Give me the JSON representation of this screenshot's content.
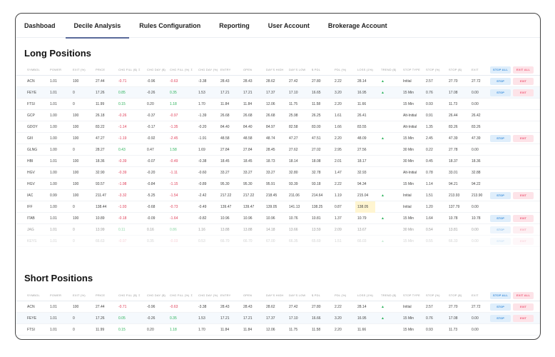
{
  "tabs": [
    "Dashboad",
    "Decile Analysis",
    "Rules Configuration",
    "Reporting",
    "User Account",
    "Brokerage Account"
  ],
  "active_tab": 1,
  "columns": [
    "SYMBOL",
    "POWER",
    "EXIT (%)",
    "PRICE",
    "CHG FILL ($) ⇳",
    "CHG DAY ($)",
    "CHG FILL (%) ⇳",
    "CHG DAY (%)",
    "ENTRY",
    "OPEN",
    "DAY'S HIGH",
    "DAY'S LOW",
    "$ PDL",
    "PDL (%)",
    "LOSS (1%)",
    "TREND ($)",
    "STOP TYPE",
    "STOP (%)",
    "STOP ($)",
    "EXIT"
  ],
  "buttons": {
    "stop_all": "STOP ALL",
    "exit_all": "EXIT ALL",
    "stop": "STOP",
    "exit": "EXIT"
  },
  "trend_icon": "▲",
  "long": {
    "title": "Long Positions",
    "rows": [
      [
        "ACN",
        "1.01",
        "100",
        "27.44",
        "-0.71",
        "-0.96",
        "-0.63",
        "-3.38",
        "28.43",
        "28.43",
        "28.62",
        "27.42",
        "27.80",
        "2.22",
        "28.14",
        "up",
        "Initial",
        "2.57",
        "27.70",
        "27.72",
        true
      ],
      [
        "FEYE",
        "1.01",
        "0",
        "17.26",
        "0.85",
        "-0.26",
        "0.35",
        "1.53",
        "17.21",
        "17.21",
        "17.37",
        "17.10",
        "16.65",
        "3.20",
        "16.95",
        "up",
        "15 Min",
        "0.76",
        "17.08",
        "0.00",
        true
      ],
      [
        "FTSI",
        "1.01",
        "0",
        "11.99",
        "0.15",
        "0.20",
        "1.18",
        "1.70",
        "11.84",
        "11.84",
        "12.06",
        "11.75",
        "11.58",
        "2.20",
        "11.66",
        "",
        "15 Min",
        "0.93",
        "11.73",
        "0.00",
        false
      ],
      [
        "GCP",
        "1.00",
        "100",
        "26.18",
        "-0.26",
        "-0.37",
        "-0.97",
        "-1.39",
        "26.68",
        "26.68",
        "26.68",
        "25.98",
        "26.25",
        "1.61",
        "26.41",
        "",
        "Alt-Initial",
        "0.91",
        "26.44",
        "26.42",
        false
      ],
      [
        "GDOY",
        "1.00",
        "100",
        "83.22",
        "-1.14",
        "-0.17",
        "-1.35",
        "-0.20",
        "84.40",
        "84.40",
        "84.97",
        "82.58",
        "83.00",
        "1.66",
        "83.55",
        "",
        "Alt-Initial",
        "1.35",
        "83.26",
        "83.26",
        false
      ],
      [
        "GIII",
        "1.00",
        "100",
        "47.27",
        "-1.19",
        "-0.92",
        "-2.45",
        "-1.91",
        "48.58",
        "48.58",
        "48.74",
        "47.27",
        "47.51",
        "2.20",
        "48.09",
        "up",
        "15 Min",
        "2.45",
        "47.39",
        "47.39",
        true
      ],
      [
        "GLNG",
        "1.00",
        "0",
        "28.27",
        "0.43",
        "0.47",
        "1.58",
        "1.69",
        "27.84",
        "27.84",
        "28.45",
        "27.62",
        "27.02",
        "2.95",
        "27.56",
        "",
        "30 Min",
        "0.22",
        "27.78",
        "0.00",
        false
      ],
      [
        "HBI",
        "1.01",
        "100",
        "18.36",
        "-0.39",
        "-0.07",
        "-0.49",
        "-0.38",
        "18.45",
        "18.45",
        "18.73",
        "18.14",
        "18.08",
        "2.01",
        "18.17",
        "",
        "30 Min",
        "0.45",
        "18.37",
        "18.36",
        false
      ],
      [
        "HGV",
        "1.00",
        "100",
        "32.90",
        "-0.39",
        "-0.20",
        "-1.11",
        "-0.60",
        "33.27",
        "33.27",
        "33.27",
        "32.80",
        "32.78",
        "1.47",
        "32.93",
        "",
        "Alt-Initial",
        "0.78",
        "33.01",
        "32.88",
        false
      ],
      [
        "HGV",
        "1.00",
        "100",
        "93.57",
        "-1.98",
        "-0.84",
        "-1.15",
        "-0.89",
        "95.30",
        "95.30",
        "95.91",
        "93.39",
        "93.18",
        "2.22",
        "94.34",
        "",
        "15 Min",
        "1.14",
        "94.21",
        "94.22",
        false
      ],
      [
        "IAC",
        "0.99",
        "100",
        "211.47",
        "-3.32",
        "-5.25",
        "-1.54",
        "-2.42",
        "217.22",
        "217.22",
        "218.45",
        "211.06",
        "214.64",
        "1.19",
        "215.04",
        "up",
        "Initial",
        "1.51",
        "213.93",
        "213.90",
        true
      ],
      [
        "IFF",
        "1.00",
        "0",
        "138.44",
        "-1.93",
        "-0.68",
        "-0.73",
        "-0.49",
        "139.47",
        "139.47",
        "139.05",
        "141.13",
        "138.25",
        "0.87",
        "138.05",
        "",
        "Initial",
        "1.20",
        "137.79",
        "0.00",
        false
      ],
      [
        "ITAB",
        "1.01",
        "100",
        "10.89",
        "-0.18",
        "-0.09",
        "-1.64",
        "-0.82",
        "10.96",
        "10.96",
        "10.96",
        "10.76",
        "10.81",
        "1.37",
        "10.79",
        "up",
        "15 Min",
        "1.64",
        "10.78",
        "10.78",
        true
      ],
      [
        "JAG",
        "1.01",
        "0",
        "13.99",
        "0.11",
        "0.16",
        "0.86",
        "1.16",
        "13.88",
        "13.88",
        "14.18",
        "13.66",
        "13.59",
        "2.09",
        "13.67",
        "",
        "30 Min",
        "0.54",
        "13.81",
        "0.00",
        true
      ],
      [
        "KEYS",
        "1.01",
        "0",
        "66.63",
        "-0.97",
        "0.35",
        "-0.03",
        "0.53",
        "66.70",
        "66.70",
        "67.00",
        "66.35",
        "65.69",
        "1.51",
        "66.03",
        "up",
        "15 Min",
        "0.55",
        "66.33",
        "0.00",
        true
      ]
    ]
  },
  "short": {
    "title": "Short Positions",
    "rows": [
      [
        "ACN",
        "1.01",
        "100",
        "27.44",
        "-0.71",
        "-0.96",
        "-0.63",
        "-3.38",
        "28.43",
        "28.43",
        "28.62",
        "27.42",
        "27.80",
        "2.22",
        "28.14",
        "up",
        "Initial",
        "2.57",
        "27.70",
        "27.72",
        true
      ],
      [
        "FEYE",
        "1.01",
        "0",
        "17.26",
        "0.05",
        "-0.26",
        "0.35",
        "1.53",
        "17.21",
        "17.21",
        "17.37",
        "17.10",
        "16.66",
        "3.20",
        "16.95",
        "up",
        "15 Min",
        "0.76",
        "17.08",
        "0.00",
        true
      ],
      [
        "FTSI",
        "1.01",
        "0",
        "11.99",
        "0.15",
        "0.20",
        "1.18",
        "1.70",
        "11.84",
        "11.84",
        "12.06",
        "11.75",
        "11.58",
        "2.20",
        "11.66",
        "",
        "15 Min",
        "0.93",
        "11.73",
        "0.00",
        false
      ]
    ]
  },
  "colors": {
    "negative": "#e0405a",
    "positive": "#2bb25a",
    "stop": "#3f8fdc",
    "exit": "#ef5b78",
    "highlight_loss": "#fff5d1"
  }
}
